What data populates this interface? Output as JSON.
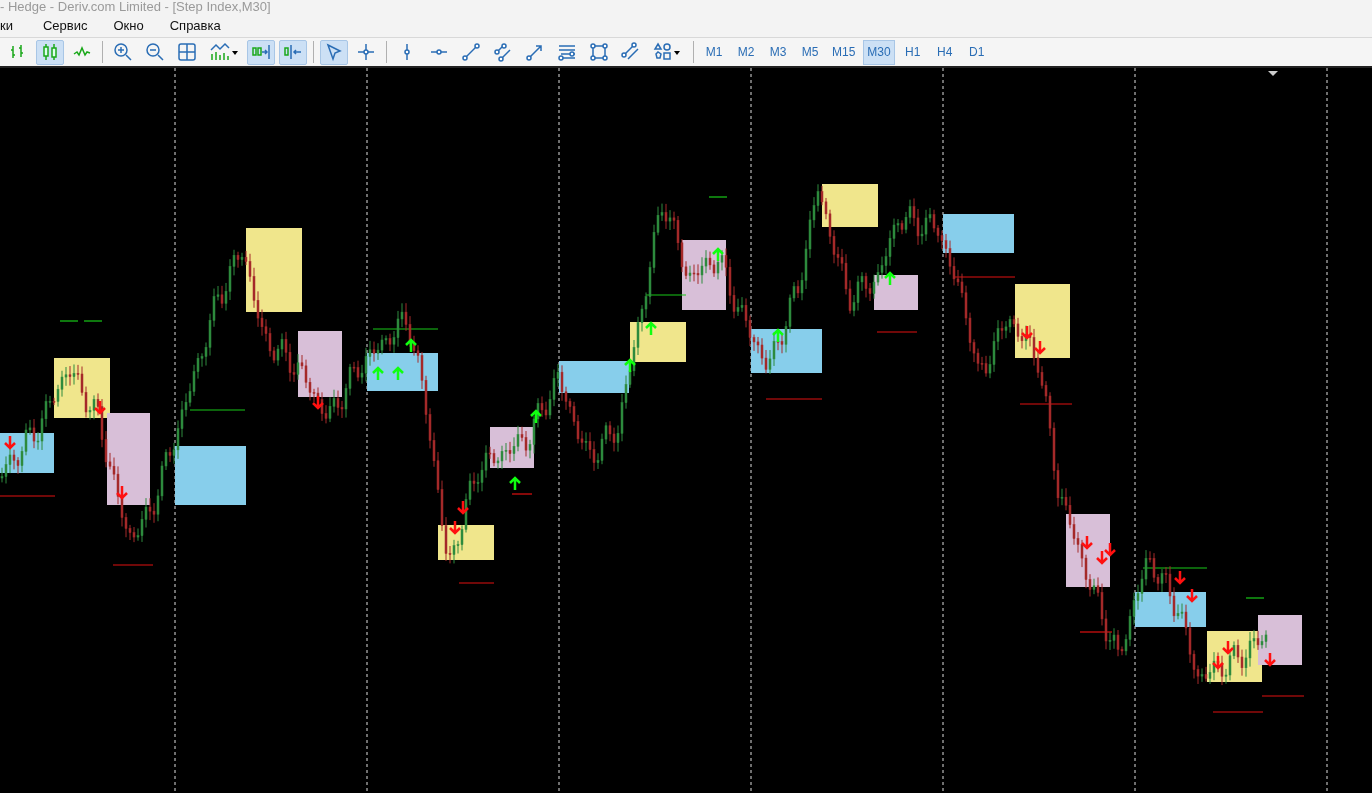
{
  "window": {
    "title": "- Hedge - Deriv.com Limited - [Step Index,M30]"
  },
  "menu": [
    "ки",
    "Сервис",
    "Окно",
    "Справка"
  ],
  "toolbar": [
    {
      "kind": "bars",
      "selected": false
    },
    {
      "kind": "candles",
      "selected": true
    },
    {
      "kind": "line",
      "selected": false
    },
    {
      "kind": "separator"
    },
    {
      "kind": "zoom-in",
      "selected": false
    },
    {
      "kind": "zoom-out",
      "selected": false
    },
    {
      "kind": "tile",
      "selected": false
    },
    {
      "kind": "indicators",
      "selected": false
    },
    {
      "kind": "autoscroll",
      "selected": true
    },
    {
      "kind": "shift",
      "selected": true
    },
    {
      "kind": "separator"
    },
    {
      "kind": "cursor",
      "selected": true
    },
    {
      "kind": "crosshair",
      "selected": false
    },
    {
      "kind": "separator"
    },
    {
      "kind": "vline",
      "selected": false
    },
    {
      "kind": "hline",
      "selected": false
    },
    {
      "kind": "trendline",
      "selected": false
    },
    {
      "kind": "equidistant",
      "selected": false
    },
    {
      "kind": "arrowline",
      "selected": false
    },
    {
      "kind": "fibo",
      "selected": false
    },
    {
      "kind": "rectangle",
      "selected": false
    },
    {
      "kind": "channel",
      "selected": false
    },
    {
      "kind": "shapes",
      "selected": false
    },
    {
      "kind": "separator"
    }
  ],
  "timeframes": [
    {
      "label": "M1",
      "selected": false
    },
    {
      "label": "M2",
      "selected": false
    },
    {
      "label": "M3",
      "selected": false
    },
    {
      "label": "M5",
      "selected": false
    },
    {
      "label": "M15",
      "selected": false
    },
    {
      "label": "M30",
      "selected": true
    },
    {
      "label": "H1",
      "selected": false
    },
    {
      "label": "H4",
      "selected": false
    },
    {
      "label": "D1",
      "selected": false
    }
  ]
}
